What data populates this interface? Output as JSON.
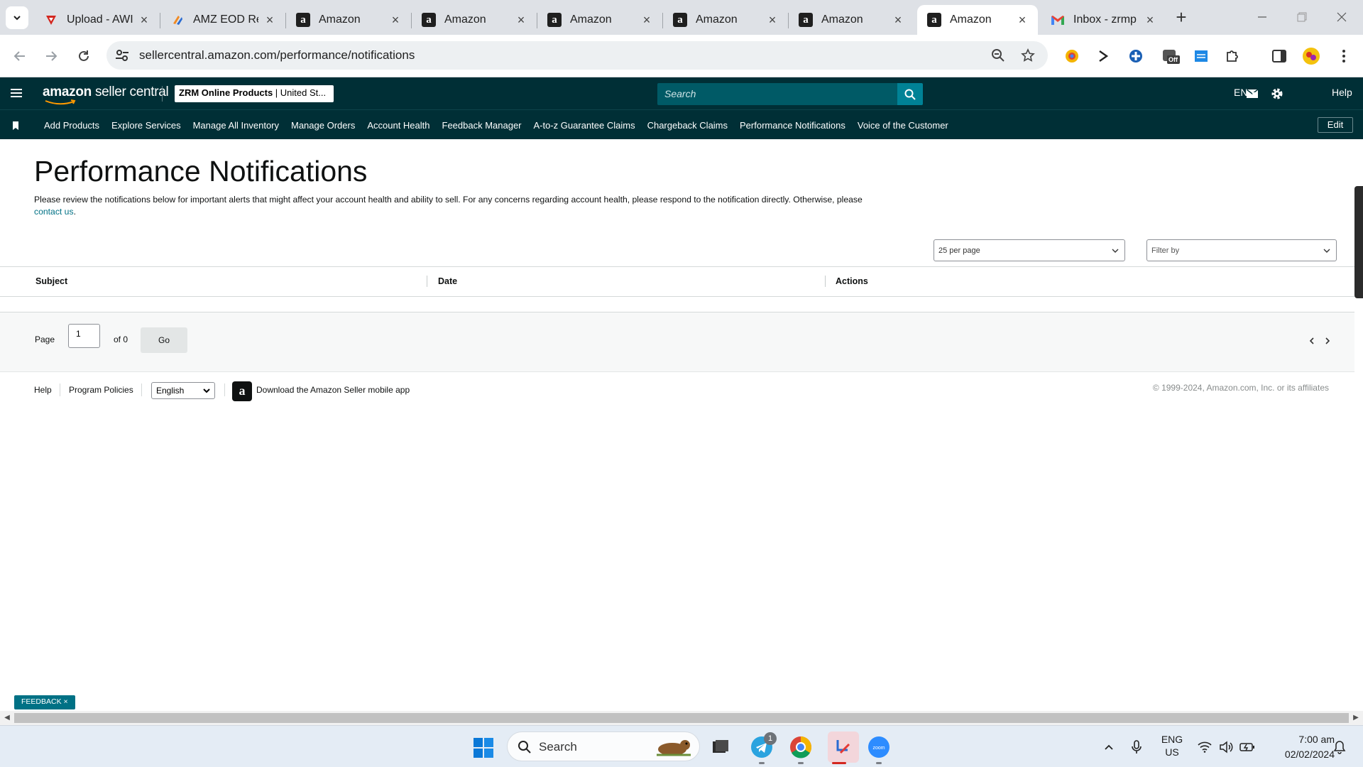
{
  "browser": {
    "tabs": [
      {
        "title": "Upload - AWI",
        "favicon": "rocket-red"
      },
      {
        "title": "AMZ EOD Rep",
        "favicon": "orange-logo"
      },
      {
        "title": "Amazon",
        "favicon": "amazon"
      },
      {
        "title": "Amazon",
        "favicon": "amazon"
      },
      {
        "title": "Amazon",
        "favicon": "amazon"
      },
      {
        "title": "Amazon",
        "favicon": "amazon"
      },
      {
        "title": "Amazon",
        "favicon": "amazon"
      },
      {
        "title": "Amazon",
        "favicon": "amazon",
        "active": true
      },
      {
        "title": "Inbox - zrmp",
        "favicon": "gmail"
      }
    ],
    "url": "sellercentral.amazon.com/performance/notifications",
    "extension_badge": "Off"
  },
  "header": {
    "logo_brand": "amazon",
    "logo_product": "seller central",
    "store_name": "ZRM Online Products",
    "store_region": "United St...",
    "search_placeholder": "Search",
    "language": "EN",
    "help": "Help"
  },
  "nav": {
    "links": [
      "Add Products",
      "Explore Services",
      "Manage All Inventory",
      "Manage Orders",
      "Account Health",
      "Feedback Manager",
      "A-to-z Guarantee Claims",
      "Chargeback Claims",
      "Performance Notifications",
      "Voice of the Customer"
    ],
    "edit_label": "Edit"
  },
  "page": {
    "title": "Performance Notifications",
    "description": "Please review the notifications below for important alerts that might affect your account health and ability to sell. For any concerns regarding account health, please respond to the notification directly. Otherwise, please",
    "contact_link": "contact us",
    "per_page": "25 per page",
    "filter_placeholder": "Filter by",
    "table_columns": [
      "Subject",
      "Date",
      "Actions"
    ],
    "pager": {
      "page_label": "Page",
      "page_value": "1",
      "of_label": "of 0",
      "go_label": "Go"
    }
  },
  "footer": {
    "help": "Help",
    "program_policies": "Program Policies",
    "language": "English",
    "app_promo": "Download the Amazon Seller mobile app",
    "copyright": "© 1999-2024, Amazon.com, Inc. or its affiliates"
  },
  "feedback_label": "FEEDBACK",
  "taskbar": {
    "search_label": "Search",
    "telegram_badge": "1",
    "lang_line1": "ENG",
    "lang_line2": "US",
    "time": "7:00 am",
    "date": "02/02/2024"
  },
  "colors": {
    "header_bg": "#002f36",
    "search_bg": "#005a66",
    "search_button": "#008296",
    "link": "#007185"
  }
}
